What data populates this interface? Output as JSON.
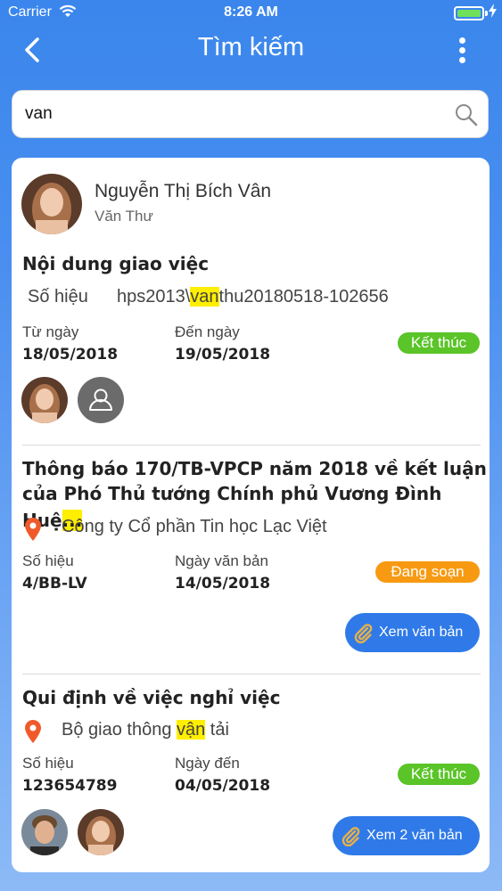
{
  "status_bar": {
    "carrier": "Carrier",
    "time": "8:26 AM",
    "battery_level": 1.0,
    "battery_color": "#6ee05a"
  },
  "header": {
    "title": "Tìm kiếm",
    "back_icon": "chevron-left-icon",
    "menu_icon": "more-vertical-icon"
  },
  "search": {
    "value": "van",
    "icon": "search-icon"
  },
  "results": [
    {
      "person_name": "Nguyễn Thị Bích Vân",
      "person_role": "Văn Thư",
      "title": "Nội dung giao việc",
      "code_label": "Số hiệu",
      "code_before": "hps2013\\",
      "code_highlight": "van",
      "code_after": "thu20180518-102656",
      "from_label": "Từ ngày",
      "from_value": "18/05/2018",
      "to_label": "Đến ngày",
      "to_value": "19/05/2018",
      "status": "Kết thúc",
      "status_color": "#5ac428"
    },
    {
      "title_line1": "Thông báo 170/TB-VPCP năm 2018 về kết luận",
      "title_line2": "của Phó Thủ tướng Chính phủ Vương Đình Huệ",
      "title_ellipsis": "...",
      "org": "Công ty Cổ phần Tin học Lạc Việt",
      "code_label": "Số hiệu",
      "code_value": "4/BB-LV",
      "date_label": "Ngày văn bản",
      "date_value": "14/05/2018",
      "status": "Đang soạn",
      "status_color": "#f79a12",
      "button_label": "Xem văn bản"
    },
    {
      "title": "Qui định về việc nghỉ việc",
      "org_before": "Bộ giao thông ",
      "org_highlight": "vận",
      "org_after": " tải",
      "code_label": "Số hiệu",
      "code_value": "123654789",
      "date_label": "Ngày đến",
      "date_value": "04/05/2018",
      "status": "Kết thúc",
      "status_color": "#5ac428",
      "button_label": "Xem 2 văn bản"
    }
  ],
  "accent_color": "#2f7ae8",
  "highlight_color": "#ffee00"
}
